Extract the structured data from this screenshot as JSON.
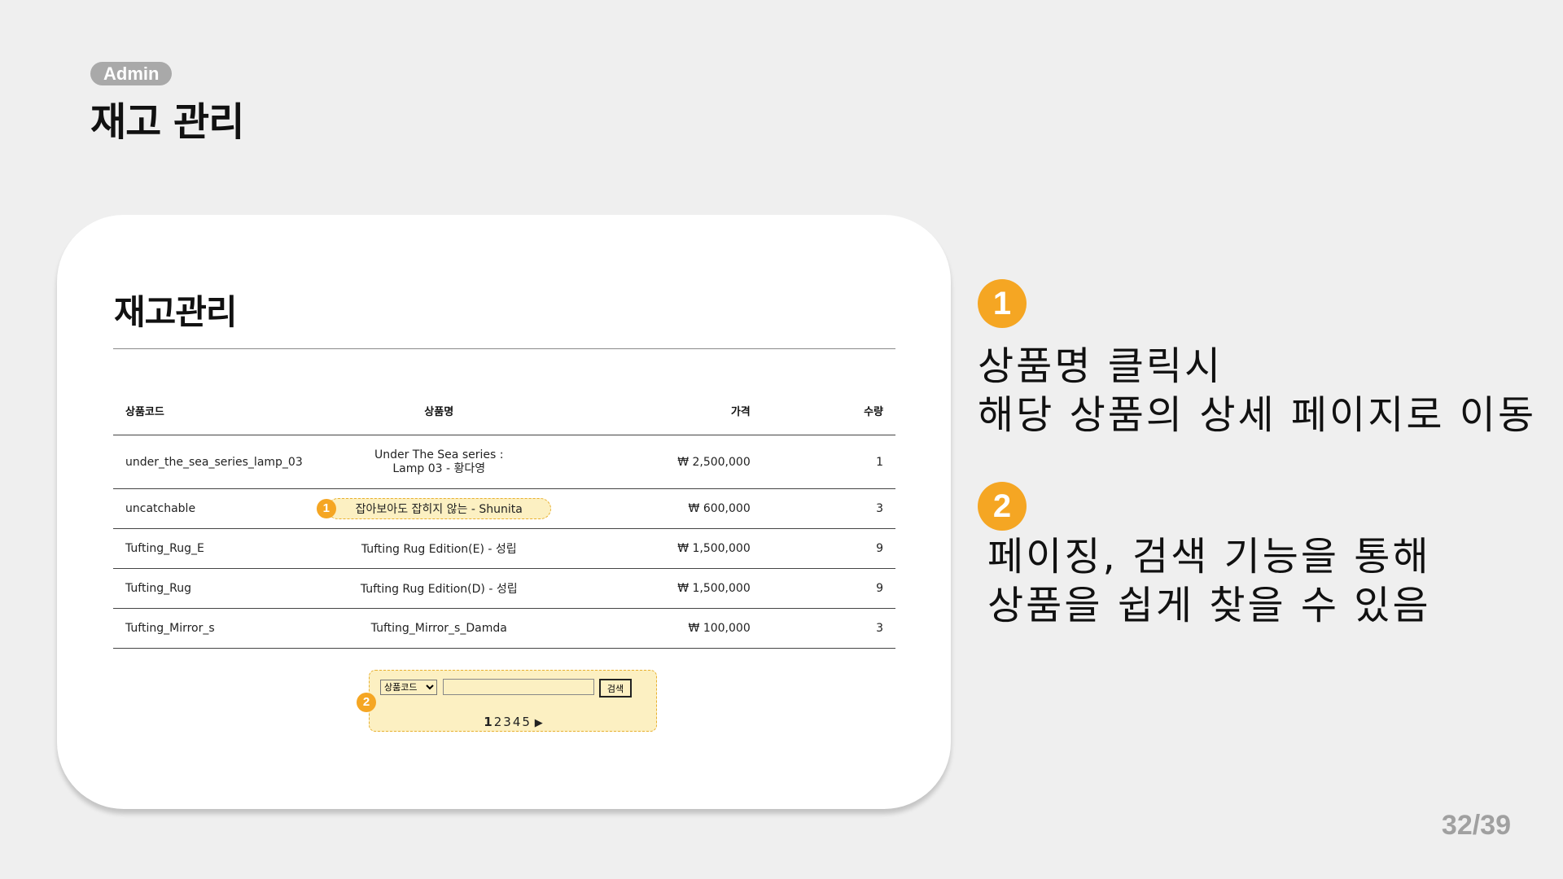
{
  "header": {
    "badge": "Admin",
    "title": "재고 관리"
  },
  "screen": {
    "title": "재고관리",
    "table": {
      "headers": {
        "code": "상품코드",
        "name": "상품명",
        "price": "가격",
        "qty": "수량"
      },
      "rows": [
        {
          "code": "under_the_sea_series_lamp_03",
          "name": "Under The Sea series : Lamp 03 - 황다영",
          "price": "₩ 2,500,000",
          "qty": "1"
        },
        {
          "code": "uncatchable",
          "name": "잡아보아도 잡히지 않는 - Shunita",
          "price": "₩ 600,000",
          "qty": "3"
        },
        {
          "code": "Tufting_Rug_E",
          "name": "Tufting Rug Edition(E) - 성립",
          "price": "₩ 1,500,000",
          "qty": "9"
        },
        {
          "code": "Tufting_Rug",
          "name": "Tufting Rug Edition(D) - 성립",
          "price": "₩ 1,500,000",
          "qty": "9"
        },
        {
          "code": "Tufting_Mirror_s",
          "name": "Tufting_Mirror_s_Damda",
          "price": "₩ 100,000",
          "qty": "3"
        }
      ]
    },
    "search": {
      "select_value": "상품코드",
      "input_value": "",
      "button_label": "검색",
      "pages": [
        "1",
        "2",
        "3",
        "4",
        "5"
      ],
      "current_page": "1",
      "next_symbol": "▶"
    },
    "markers": {
      "name_marker": "1",
      "search_marker": "2"
    }
  },
  "features": [
    {
      "number": "1",
      "line1": "상품명 클릭시",
      "line2": "해당 상품의 상세 페이지로 이동"
    },
    {
      "number": "2",
      "line1": "페이징, 검색 기능을 통해",
      "line2": "상품을 쉽게 찾을 수 있음"
    }
  ],
  "accent_color": "#f5a623",
  "highlight_color": "#fcf0c2",
  "page_counter": "32/39"
}
